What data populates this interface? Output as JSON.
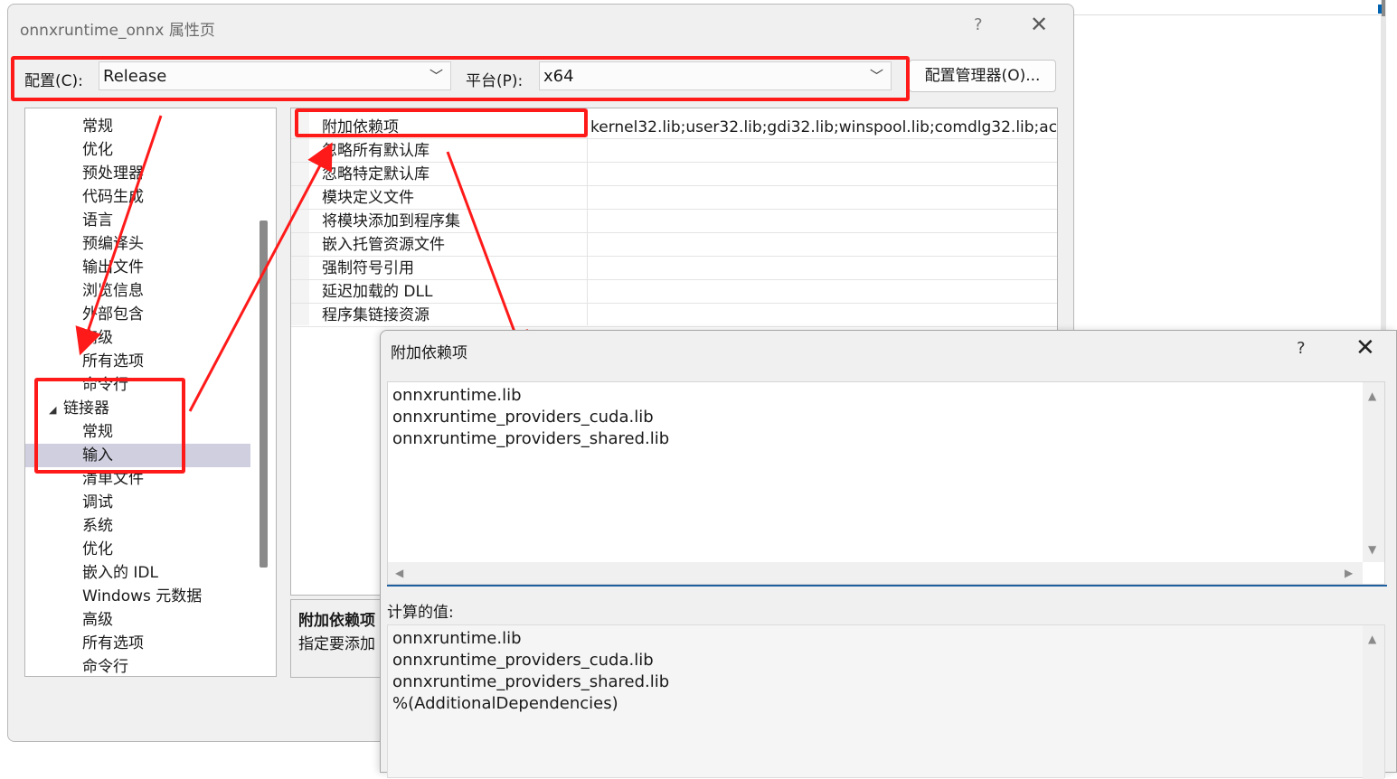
{
  "dialog": {
    "title": "onnxruntime_onnx 属性页",
    "help_glyph": "?",
    "close_glyph": "✕",
    "config_label": "配置(C):",
    "config_value": "Release",
    "platform_label": "平台(P):",
    "platform_value": "x64",
    "config_manager_label": "配置管理器(O)..."
  },
  "tree": {
    "items": [
      {
        "label": "常规"
      },
      {
        "label": "优化"
      },
      {
        "label": "预处理器"
      },
      {
        "label": "代码生成"
      },
      {
        "label": "语言"
      },
      {
        "label": "预编译头"
      },
      {
        "label": "输出文件"
      },
      {
        "label": "浏览信息"
      },
      {
        "label": "外部包含"
      },
      {
        "label": "高级"
      },
      {
        "label": "所有选项"
      },
      {
        "label": "命令行"
      },
      {
        "label": "链接器",
        "expanded_glyph": "◢"
      },
      {
        "label": "常规"
      },
      {
        "label": "输入"
      },
      {
        "label": "清单文件"
      },
      {
        "label": "调试"
      },
      {
        "label": "系统"
      },
      {
        "label": "优化"
      },
      {
        "label": "嵌入的 IDL"
      },
      {
        "label": "Windows 元数据"
      },
      {
        "label": "高级"
      },
      {
        "label": "所有选项"
      },
      {
        "label": "命令行"
      }
    ]
  },
  "grid": {
    "rows": [
      {
        "name": "附加依赖项",
        "value": "kernel32.lib;user32.lib;gdi32.lib;winspool.lib;comdlg32.lib;ac"
      },
      {
        "name": "忽略所有默认库",
        "value": ""
      },
      {
        "name": "忽略特定默认库",
        "value": ""
      },
      {
        "name": "模块定义文件",
        "value": ""
      },
      {
        "name": "将模块添加到程序集",
        "value": ""
      },
      {
        "name": "嵌入托管资源文件",
        "value": ""
      },
      {
        "name": "强制符号引用",
        "value": ""
      },
      {
        "name": "延迟加载的 DLL",
        "value": ""
      },
      {
        "name": "程序集链接资源",
        "value": ""
      }
    ],
    "desc_title": "附加依赖项",
    "desc_text": "指定要添加"
  },
  "popup": {
    "title": "附加依赖项",
    "help_glyph": "?",
    "close_glyph": "✕",
    "lines": [
      "onnxruntime.lib",
      "onnxruntime_providers_cuda.lib",
      "onnxruntime_providers_shared.lib"
    ],
    "computed_label": "计算的值:",
    "computed_lines": [
      "onnxruntime.lib",
      "onnxruntime_providers_cuda.lib",
      "onnxruntime_providers_shared.lib",
      "%(AdditionalDependencies)"
    ],
    "scroll_up": "▲",
    "scroll_down": "▼",
    "scroll_left": "◀",
    "scroll_right": "▶"
  },
  "colors": {
    "annotation_red": "#ff1a1a",
    "selection": "#cfcfe0",
    "accent_blue": "#1f5f9f"
  }
}
